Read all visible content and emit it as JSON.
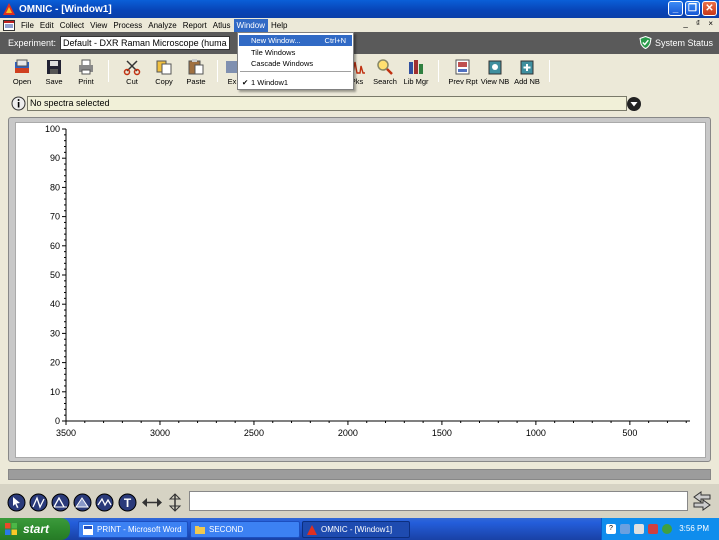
{
  "window": {
    "title": "OMNIC - [Window1]"
  },
  "menubar": {
    "items": [
      "File",
      "Edit",
      "Collect",
      "View",
      "Process",
      "Analyze",
      "Report",
      "Atlus",
      "Window",
      "Help"
    ],
    "mdi_buttons": "_ ₫ ×"
  },
  "experiment": {
    "label": "Experiment:",
    "value": "Default - DXR Raman Microscope    (huma",
    "system_status": "System Status"
  },
  "toolbar": {
    "open": "Open",
    "save": "Save",
    "print": "Print",
    "cut": "Cut",
    "copy": "Copy",
    "paste": "Paste",
    "ex": "Ex",
    "pks": "Pks",
    "search": "Search",
    "libmgr": "Lib Mgr",
    "prevrpt": "Prev Rpt",
    "viewnb": "View NB",
    "addnb": "Add NB"
  },
  "selection": {
    "text": "No spectra selected"
  },
  "window_menu": {
    "new_window": "New Window...",
    "new_window_shortcut": "Ctrl+N",
    "tile": "Tile Windows",
    "cascade": "Cascade Windows",
    "window1": "1 Window1"
  },
  "chart_data": {
    "type": "line",
    "title": "",
    "xlabel": "",
    "ylabel": "",
    "x_ticks": [
      3500,
      3000,
      2500,
      2000,
      1500,
      1000,
      500
    ],
    "y_ticks": [
      0,
      10,
      20,
      30,
      40,
      50,
      60,
      70,
      80,
      90,
      100
    ],
    "xlim": [
      3500,
      180
    ],
    "ylim": [
      0,
      100
    ],
    "x_reversed": true,
    "grid": false,
    "series": []
  },
  "taskbar": {
    "start": "start",
    "tasks": [
      "PRINT - Microsoft Word",
      "SECOND",
      "OMNIC - [Window1]"
    ],
    "clock": "3:56 PM"
  },
  "colors": {
    "titlebar": "#0a4cc8",
    "menu_highlight": "#316ac5",
    "experiment_bar": "#5a5a5a",
    "taskbar": "#245edb",
    "start_button": "#2e8b2e"
  }
}
